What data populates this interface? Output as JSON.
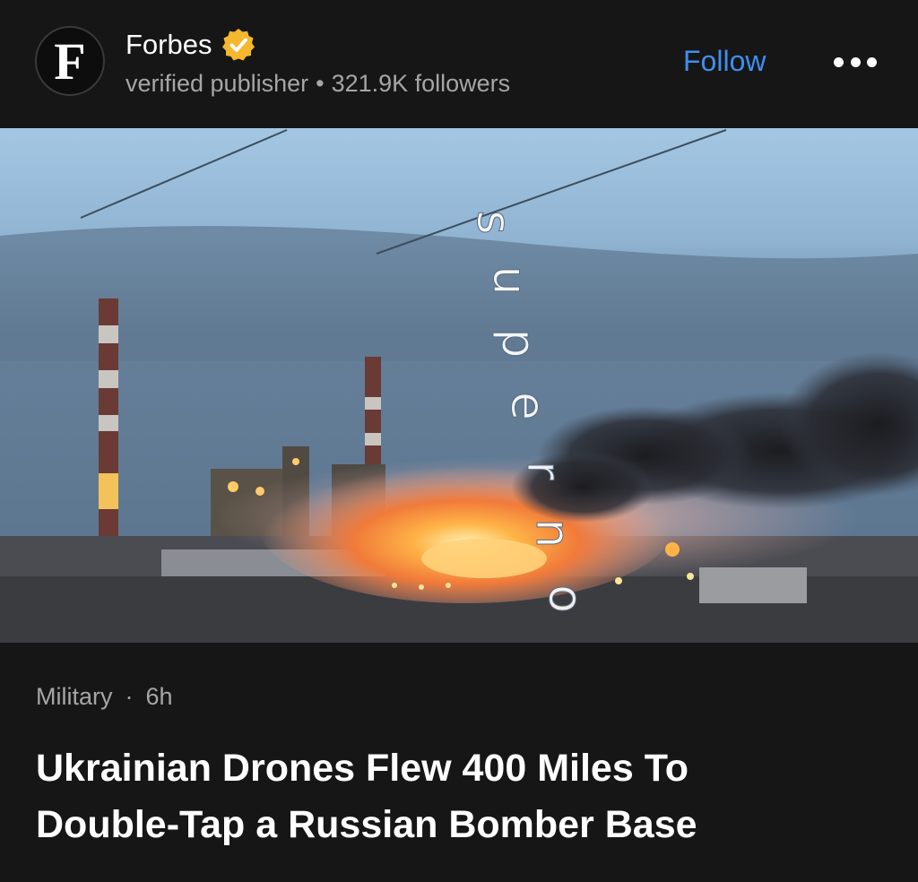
{
  "publisher": {
    "logo_letter": "F",
    "name": "Forbes",
    "badge": "verified publisher",
    "separator": "•",
    "followers": "321.9K followers",
    "verified_color": "#f5b82e"
  },
  "actions": {
    "follow_label": "Follow",
    "follow_color": "#3f8ef0",
    "more_icon": "more-horizontal-icon"
  },
  "image": {
    "watermark": "superno"
  },
  "article": {
    "category": "Military",
    "separator": "·",
    "age": "6h",
    "title_line1": "Ukrainian Drones Flew 400 Miles To",
    "title_line2": "Double-Tap a Russian Bomber Base"
  }
}
